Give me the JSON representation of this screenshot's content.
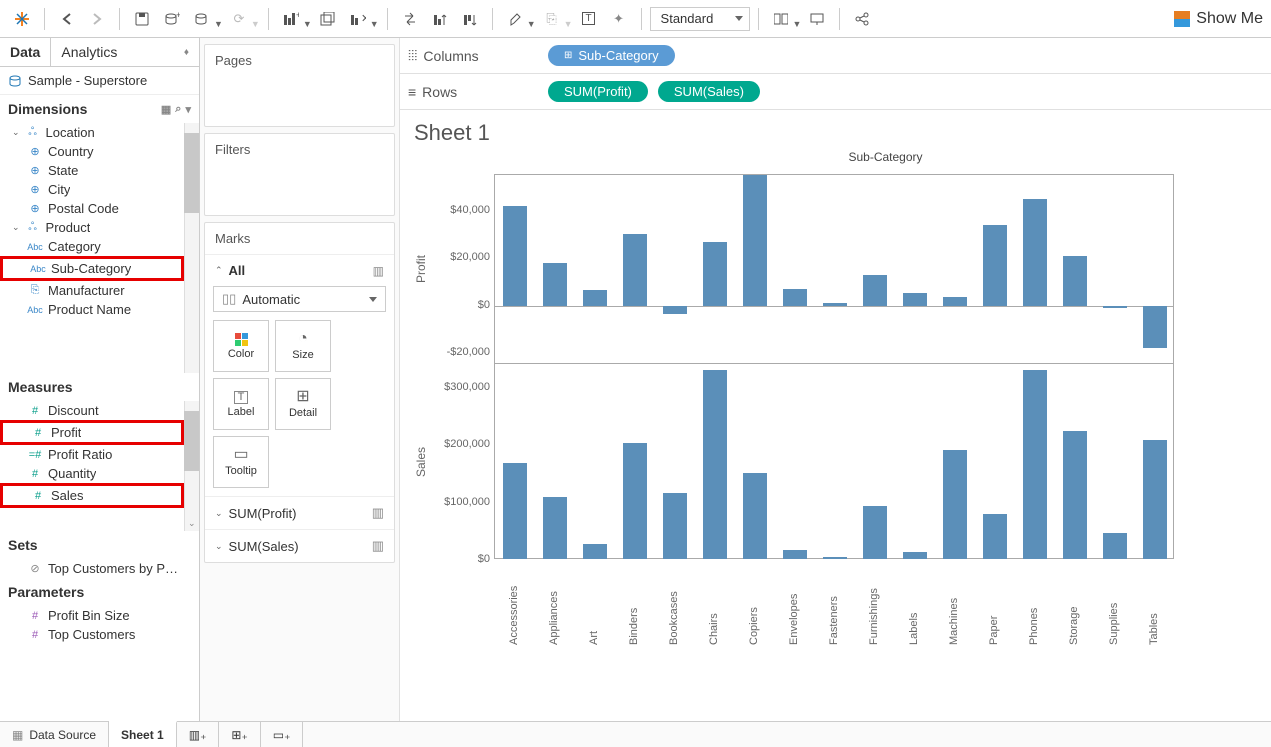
{
  "toolbar": {
    "fit_select": "Standard",
    "showme": "Show Me"
  },
  "data_panel": {
    "tab_data": "Data",
    "tab_analytics": "Analytics",
    "datasource": "Sample - Superstore",
    "dimensions_header": "Dimensions",
    "measures_header": "Measures",
    "sets_header": "Sets",
    "parameters_header": "Parameters",
    "dims_group1": "Location",
    "dims_group1_items": [
      "Country",
      "State",
      "City",
      "Postal Code"
    ],
    "dims_group2": "Product",
    "dims_group2_items": [
      "Category",
      "Sub-Category",
      "Manufacturer",
      "Product Name"
    ],
    "measures_items": [
      "Discount",
      "Profit",
      "Profit Ratio",
      "Quantity",
      "Sales"
    ],
    "sets_items": [
      "Top Customers by P…"
    ],
    "params_items": [
      "Profit Bin Size",
      "Top Customers"
    ]
  },
  "shelves": {
    "pages": "Pages",
    "filters": "Filters",
    "marks": "Marks",
    "marks_all": "All",
    "marks_type": "Automatic",
    "marks_cells": [
      "Color",
      "Size",
      "Label",
      "Detail",
      "Tooltip"
    ],
    "sum_profit": "SUM(Profit)",
    "sum_sales": "SUM(Sales)"
  },
  "rowscols": {
    "columns_label": "Columns",
    "rows_label": "Rows",
    "columns_pill": "Sub-Category",
    "rows_pill1": "SUM(Profit)",
    "rows_pill2": "SUM(Sales)"
  },
  "sheet": {
    "title": "Sheet 1",
    "columns_title": "Sub-Category",
    "profit_axis": "Profit",
    "sales_axis": "Sales"
  },
  "footer": {
    "data_source": "Data Source",
    "sheet1": "Sheet 1"
  },
  "chart_data": [
    {
      "type": "bar",
      "title": "Profit by Sub-Category",
      "ylabel": "Profit",
      "ylim": [
        -25000,
        55000
      ],
      "yticks": [
        -20000,
        0,
        20000,
        40000
      ],
      "ytick_labels": [
        "-$20,000",
        "$0",
        "$20,000",
        "$40,000"
      ],
      "categories": [
        "Accessories",
        "Appliances",
        "Art",
        "Binders",
        "Bookcases",
        "Chairs",
        "Copiers",
        "Envelopes",
        "Fasteners",
        "Furnishings",
        "Labels",
        "Machines",
        "Paper",
        "Phones",
        "Storage",
        "Supplies",
        "Tables"
      ],
      "values": [
        42000,
        18000,
        6500,
        30000,
        -3500,
        27000,
        55000,
        7000,
        1000,
        13000,
        5500,
        3500,
        34000,
        45000,
        21000,
        -1000,
        -18000
      ]
    },
    {
      "type": "bar",
      "title": "Sales by Sub-Category",
      "ylabel": "Sales",
      "ylim": [
        0,
        340000
      ],
      "yticks": [
        0,
        100000,
        200000,
        300000
      ],
      "ytick_labels": [
        "$0",
        "$100,000",
        "$200,000",
        "$300,000"
      ],
      "categories": [
        "Accessories",
        "Appliances",
        "Art",
        "Binders",
        "Bookcases",
        "Chairs",
        "Copiers",
        "Envelopes",
        "Fasteners",
        "Furnishings",
        "Labels",
        "Machines",
        "Paper",
        "Phones",
        "Storage",
        "Supplies",
        "Tables"
      ],
      "values": [
        167000,
        108000,
        27000,
        203000,
        115000,
        330000,
        150000,
        16000,
        3000,
        92000,
        12000,
        190000,
        79000,
        330000,
        224000,
        46000,
        207000
      ]
    }
  ]
}
